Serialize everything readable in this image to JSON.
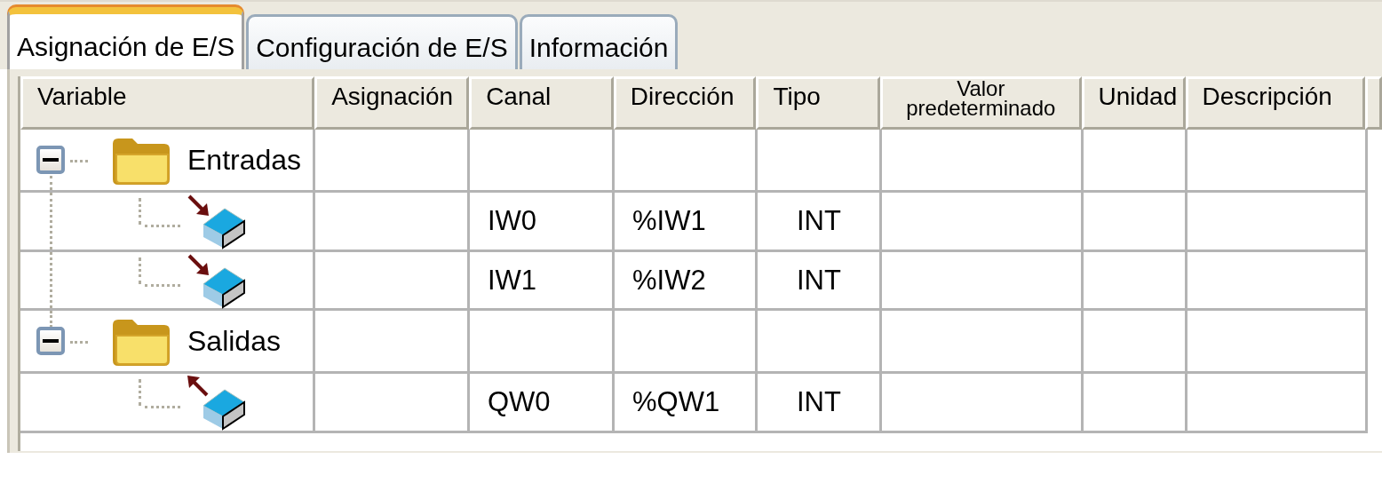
{
  "tabs": [
    {
      "label": "Asignación de E/S",
      "selected": true
    },
    {
      "label": "Configuración de E/S",
      "selected": false
    },
    {
      "label": "Información",
      "selected": false
    }
  ],
  "table": {
    "columns": [
      "Variable",
      "Asignación",
      "Canal",
      "Dirección",
      "Tipo",
      "Valor predeterminado",
      "Unidad",
      "Descripción"
    ],
    "tree": [
      {
        "label": "Entradas",
        "expanded": true,
        "children": [
          {
            "kind": "input",
            "canal": "IW0",
            "direccion": "%IW1",
            "tipo": "INT"
          },
          {
            "kind": "input",
            "canal": "IW1",
            "direccion": "%IW2",
            "tipo": "INT"
          }
        ]
      },
      {
        "label": "Salidas",
        "expanded": true,
        "children": [
          {
            "kind": "output",
            "canal": "QW0",
            "direccion": "%QW1",
            "tipo": "INT"
          }
        ]
      }
    ]
  }
}
